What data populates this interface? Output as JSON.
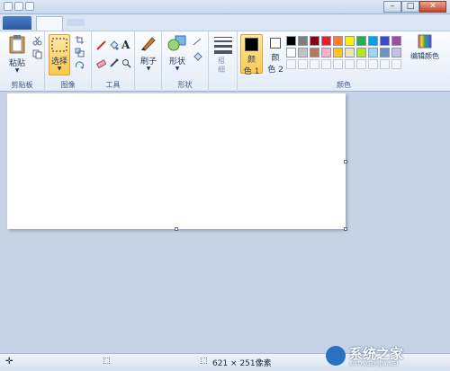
{
  "ribbon": {
    "clipboard": {
      "paste_label": "粘贴",
      "group_label": "剪贴板"
    },
    "image": {
      "select_label": "选择",
      "group_label": "图像"
    },
    "tools": {
      "group_label": "工具"
    },
    "brushes": {
      "label": "刷子"
    },
    "shapes": {
      "label": "形状",
      "group_label": "形状"
    },
    "size": {
      "label_top": "粗",
      "label_bottom": "细"
    },
    "colors": {
      "color1_line1": "颜",
      "color1_line2": "色 1",
      "color2_line1": "颜",
      "color2_line2": "色 2",
      "edit_colors_label": "编辑颜色",
      "group_label": "颜色",
      "color1_value": "#000000",
      "color2_value": "#ffffff",
      "palette_row1": [
        "#000000",
        "#7f7f7f",
        "#880015",
        "#ed1c24",
        "#ff7f27",
        "#fff200",
        "#22b14c",
        "#00a2e8",
        "#3f48cc",
        "#a349a4"
      ],
      "palette_row2": [
        "#ffffff",
        "#c3c3c3",
        "#b97a57",
        "#ffaec9",
        "#ffc90e",
        "#efe4b0",
        "#b5e61d",
        "#99d9ea",
        "#7092be",
        "#c8bfe7"
      ]
    }
  },
  "status": {
    "canvas_size": "621 × 251像素"
  },
  "watermark": {
    "brand": "系统之家",
    "site": "XITONGZHIJIA.NET"
  }
}
